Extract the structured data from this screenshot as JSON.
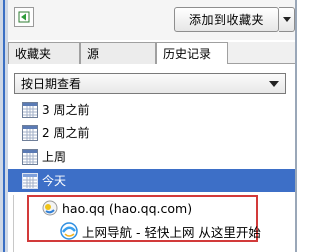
{
  "toolbar": {
    "back_icon": "arrow-left-icon",
    "add_favorite_label": "添加到收藏夹",
    "dropdown_icon": "chevron-down-icon"
  },
  "tabs": [
    {
      "label": "收藏夹",
      "active": false
    },
    {
      "label": "源",
      "active": false
    },
    {
      "label": "历史记录",
      "active": true
    }
  ],
  "filter": {
    "selected": "按日期查看"
  },
  "history": {
    "groups": [
      {
        "label": "3 周之前",
        "icon": "calendar-icon",
        "selected": false
      },
      {
        "label": "2 周之前",
        "icon": "calendar-icon",
        "selected": false
      },
      {
        "label": "上周",
        "icon": "calendar-icon",
        "selected": false
      },
      {
        "label": "今天",
        "icon": "calendar-icon",
        "selected": true
      }
    ],
    "site": {
      "label": "hao.qq (hao.qq.com)",
      "icon": "site-globe-icon"
    },
    "page": {
      "label": "上网导航 - 轻快上网 从这里开始",
      "icon": "browser-page-icon"
    }
  },
  "colors": {
    "selection": "#3d6fc7",
    "highlight_border": "#d23a3a"
  }
}
